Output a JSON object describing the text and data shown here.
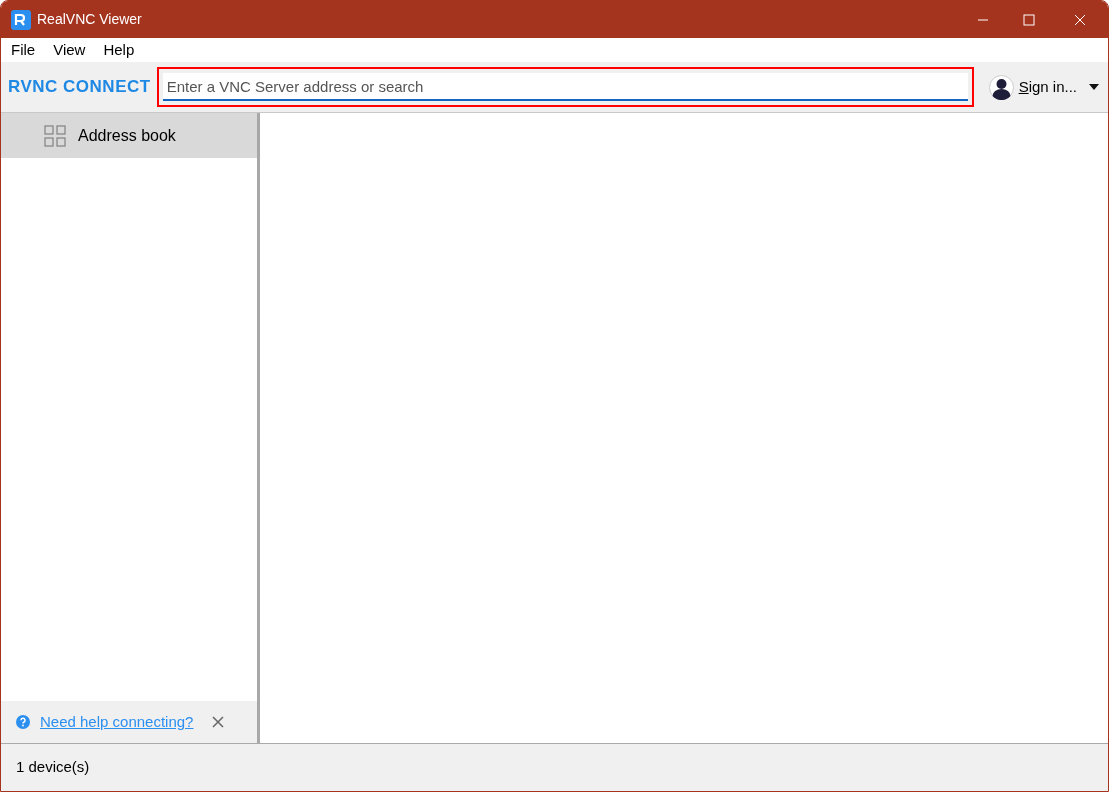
{
  "window": {
    "title": "RealVNC Viewer"
  },
  "menu": [
    "File",
    "View",
    "Help"
  ],
  "toolbar": {
    "logo": "RVNC CONNECT",
    "search": {
      "placeholder": "Enter a VNC Server address or search"
    },
    "sign_in": "Sign in..."
  },
  "sidebar": {
    "items": [
      {
        "label": "Address book",
        "selected": true
      }
    ],
    "help_link": "Need help connecting?"
  },
  "status_bar": "1 device(s)"
}
